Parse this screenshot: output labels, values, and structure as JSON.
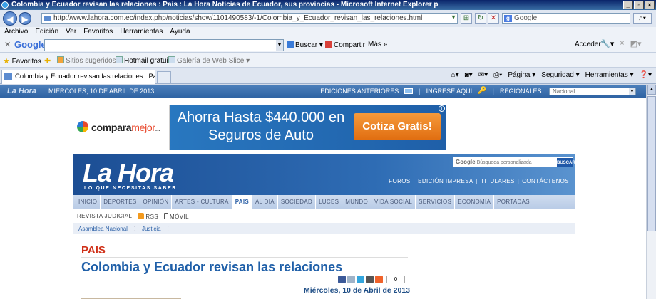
{
  "browser": {
    "window_title": "Colombia y Ecuador revisan las relaciones : Pais : La Hora Noticias de Ecuador, sus provincias  - Microsoft Internet Explorer p",
    "url": "http://www.lahora.com.ec/index.php/noticias/show/1101490583/-1/Colombia_y_Ecuador_revisan_las_relaciones.html",
    "search_placeholder": "Google",
    "menu": [
      "Archivo",
      "Edición",
      "Ver",
      "Favoritos",
      "Herramientas",
      "Ayuda"
    ],
    "google_toolbar": {
      "logo": "Google",
      "buscar": "Buscar",
      "compartir": "Compartir",
      "mas": "Más »",
      "acceder": "Acceder"
    },
    "favorites": {
      "label": "Favoritos",
      "items": [
        "Sitios sugeridos",
        "Hotmail gratuito",
        "Galería de Web Slice"
      ]
    },
    "tab_title": "Colombia y Ecuador revisan las relaciones : Pais : La H...",
    "commands": [
      "Página",
      "Seguridad",
      "Herramientas"
    ]
  },
  "site": {
    "topstrip": {
      "logo": "La Hora",
      "date": "MIÉRCOLES, 10 DE ABRIL DE 2013",
      "ediciones": "EDICIONES ANTERIORES",
      "ingrese": "INGRESE AQUI",
      "regionales": "REGIONALES:",
      "regional_value": "Nacional"
    },
    "ad": {
      "brand_a": "compara",
      "brand_b": "mejor",
      "brand_dots": "...",
      "headline": "Ahorra Hasta $440.000 en Seguros de Auto",
      "cta": "Cotiza Gratis!"
    },
    "header": {
      "brand": "La Hora",
      "slogan": "LO QUE NECESITAS SABER",
      "search_placeholder": "Búsqueda personalizada",
      "google_label": "Google",
      "search_button": "BUSCAR",
      "links": [
        "FOROS",
        "EDICIÓN IMPRESA",
        "TITULARES",
        "CONTÁCTENOS"
      ]
    },
    "sections": [
      "INICIO",
      "DEPORTES",
      "OPINIÓN",
      "ARTES - CULTURA",
      "PAIS",
      "AL DÍA",
      "SOCIEDAD",
      "LUCES",
      "MUNDO",
      "VIDA SOCIAL",
      "SERVICIOS",
      "ECONOMÍA",
      "PORTADAS"
    ],
    "active_section": "PAIS",
    "subnav": [
      "REVISTA JUDICIAL",
      "RSS",
      "MÓVIL"
    ],
    "tags": [
      "Asamblea Nacional",
      "Justicia"
    ],
    "article": {
      "section": "PAIS",
      "headline": "Colombia y Ecuador revisan las relaciones",
      "share_count": "0",
      "date": "Miércoles, 10 de Abril de 2013"
    }
  }
}
